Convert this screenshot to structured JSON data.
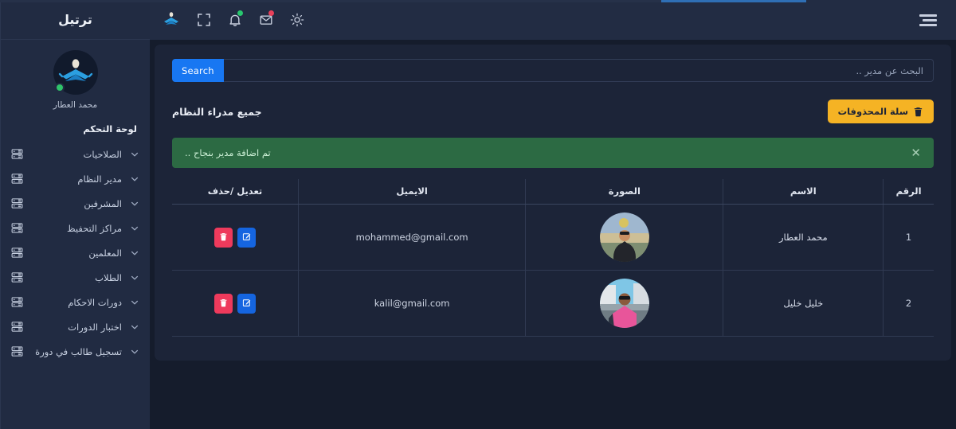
{
  "topbar": {
    "progress_percent": 18,
    "menu_icon": "hamburger-icon",
    "icons": [
      {
        "name": "brand-logo-icon",
        "badge": null
      },
      {
        "name": "fullscreen-icon",
        "badge": null
      },
      {
        "name": "bell-icon",
        "badge": "green"
      },
      {
        "name": "envelope-icon",
        "badge": "red"
      },
      {
        "name": "brightness-icon",
        "badge": null
      }
    ]
  },
  "search": {
    "button_label": "Search",
    "placeholder": "البحث عن مدير ..",
    "value": ""
  },
  "page": {
    "title": "جميع مدراء النظام",
    "trash_button_label": "سلة المحذوفات",
    "trash_icon": "trash-icon"
  },
  "alert": {
    "message": "تم اضافة مدير بنجاح ..",
    "close_label": "✕",
    "color": "#2c6a43"
  },
  "table": {
    "headers": [
      "الرقم",
      "الاسم",
      "الصورة",
      "الايميل",
      "تعديل /حذف"
    ],
    "rows": [
      {
        "id": "1",
        "name": "محمد العطار",
        "image_alt": "صورة محمد العطار",
        "email": "mohammed@gmail.com",
        "delete_icon": "trash-icon",
        "edit_icon": "pencil-square-icon"
      },
      {
        "id": "2",
        "name": "خليل خليل",
        "image_alt": "صورة خليل خليل",
        "email": "kalil@gmail.com",
        "delete_icon": "trash-icon",
        "edit_icon": "pencil-square-icon"
      }
    ]
  },
  "sidebar": {
    "brand": "ترتيل",
    "user_name": "محمد العطار",
    "avatar_icon": "quran-reader-avatar-icon",
    "online_status": "online",
    "section_title": "لوحة التحكم",
    "items": [
      {
        "label": "الصلاحيات",
        "icon": "server-icon",
        "chevron": "chevron-down-icon"
      },
      {
        "label": "مدير النظام",
        "icon": "server-icon",
        "chevron": "chevron-down-icon"
      },
      {
        "label": "المشرفين",
        "icon": "server-icon",
        "chevron": "chevron-down-icon"
      },
      {
        "label": "مراكز التحفيظ",
        "icon": "server-icon",
        "chevron": "chevron-down-icon"
      },
      {
        "label": "المعلمين",
        "icon": "server-icon",
        "chevron": "chevron-down-icon"
      },
      {
        "label": "الطلاب",
        "icon": "server-icon",
        "chevron": "chevron-down-icon"
      },
      {
        "label": "دورات الاحكام",
        "icon": "server-icon",
        "chevron": "chevron-down-icon"
      },
      {
        "label": "اختبار الدورات",
        "icon": "server-icon",
        "chevron": "chevron-down-icon"
      },
      {
        "label": "تسجيل طالب في دورة",
        "icon": "server-icon",
        "chevron": "chevron-down-icon"
      }
    ]
  },
  "colors": {
    "accent_blue": "#1877f2",
    "warning_yellow": "#f5b324",
    "danger_red": "#ee3a5c",
    "edit_blue": "#1565e0",
    "success_green": "#2c6a43",
    "sidebar_bg": "#212b42",
    "card_bg": "#1c2438",
    "page_bg": "#151c2c"
  }
}
